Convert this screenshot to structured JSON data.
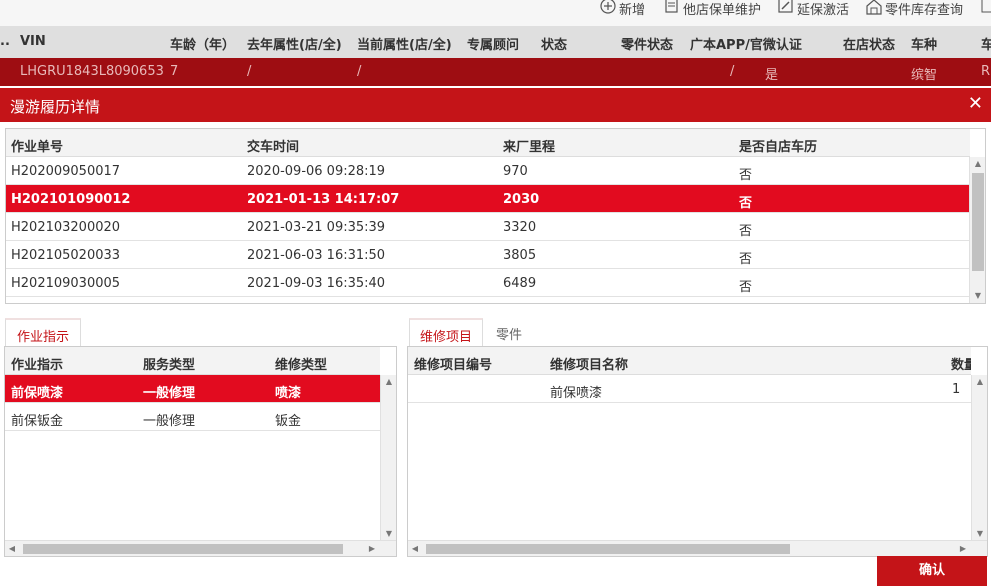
{
  "toolbar": {
    "new_label": "新增",
    "other_store_label": "他店保单维护",
    "extend_label": "延保激活",
    "parts_stock_label": "零件库存查询"
  },
  "background_table": {
    "columns": [
      "..",
      "VIN",
      "车龄（年）",
      "去年属性(店/全)",
      "当前属性(店/全)",
      "专属顾问",
      "状态",
      "零件状态",
      "广本APP/官微认证",
      "在店状态",
      "车种",
      "车"
    ],
    "row": {
      "vin": "LHGRU1843L8090653",
      "age": "7",
      "last_year": "/",
      "current": "/",
      "app_value": "/",
      "app_certified": "是",
      "model": "缤智",
      "trailing": "R"
    }
  },
  "dialog": {
    "title": "漫游履历详情",
    "close_symbol": "✕",
    "history": {
      "columns": [
        "作业单号",
        "交车时间",
        "来厂里程",
        "是否自店车历"
      ],
      "rows": [
        {
          "order": "H202009050017",
          "time": "2020-09-06 09:28:19",
          "mileage": "970",
          "own": "否"
        },
        {
          "order": "H202101090012",
          "time": "2021-01-13 14:17:07",
          "mileage": "2030",
          "own": "否",
          "selected": true
        },
        {
          "order": "H202103200020",
          "time": "2021-03-21 09:35:39",
          "mileage": "3320",
          "own": "否"
        },
        {
          "order": "H202105020033",
          "time": "2021-06-03 16:31:50",
          "mileage": "3805",
          "own": "否"
        },
        {
          "order": "H202109030005",
          "time": "2021-09-03 16:35:40",
          "mileage": "6489",
          "own": "否"
        }
      ]
    },
    "left_tab": "作业指示",
    "instructions": {
      "columns": [
        "作业指示",
        "服务类型",
        "维修类型"
      ],
      "rows": [
        {
          "instruction": "前保喷漆",
          "service": "一般修理",
          "repair": "喷漆",
          "selected": true
        },
        {
          "instruction": "前保钣金",
          "service": "一般修理",
          "repair": "钣金"
        }
      ]
    },
    "right_tabs": [
      "维修项目",
      "零件"
    ],
    "repair_items": {
      "columns": [
        "维修项目编号",
        "维修项目名称",
        "数量"
      ],
      "rows": [
        {
          "code": "",
          "name": "前保喷漆",
          "qty": "1"
        }
      ]
    },
    "confirm_label": "确认"
  },
  "colors": {
    "accent": "#c41418",
    "selected_row": "#e20b1f",
    "background_row": "#9e0d12"
  }
}
